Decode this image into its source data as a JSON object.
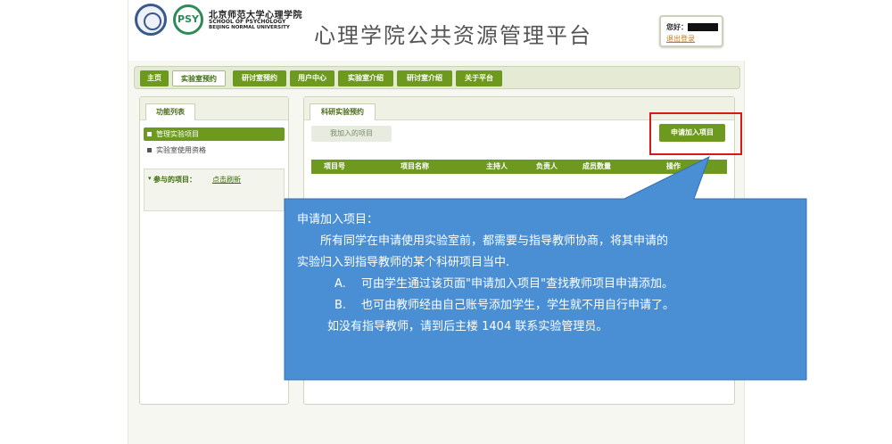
{
  "header": {
    "university_cn": "北京师范大学心理学院",
    "university_en1": "SCHOOL OF PSYCHOLOGY",
    "university_en2": "BEIJING NORMAL UNIVERSITY",
    "psy_logo_text": "PSY",
    "site_title": "心理学院公共资源管理平台",
    "greeting": "您好：",
    "logout": "退出登录"
  },
  "nav": {
    "tabs": [
      {
        "label": "主页"
      },
      {
        "label": "实验室预约"
      },
      {
        "label": "研讨室预约"
      },
      {
        "label": "用户中心"
      },
      {
        "label": "实验室介绍"
      },
      {
        "label": "研讨室介绍"
      },
      {
        "label": "关于平台"
      }
    ],
    "active_index": 1
  },
  "left_panel": {
    "title": "功能列表",
    "items": [
      {
        "label": "管理实验项目"
      },
      {
        "label": "实验室使用资格"
      }
    ],
    "projects_label": "参与的项目：",
    "projects_link": "点击刷新"
  },
  "right_panel": {
    "title": "科研实验预约",
    "sub_tab": "我加入的项目",
    "join_button": "申请加入项目",
    "columns": [
      "项目号",
      "项目名称",
      "主持人",
      "负责人",
      "成员数量",
      "操作"
    ]
  },
  "callout": {
    "heading": "申请加入项目：",
    "para1_line1": "所有同学在申请使用实验室前，都需要与指导教师协商，将其申请的",
    "para1_line2": "实验归入到指导教师的某个科研项目当中.",
    "item_a_mark": "A.",
    "item_a": "可由学生通过该页面\"申请加入项目\"查找教师项目申请添加。",
    "item_b_mark": "B.",
    "item_b": "也可由教师经由自己账号添加学生，学生就不用自行申请了。",
    "note": "如没有指导教师，请到后主楼 1404 联系实验管理员。"
  },
  "colors": {
    "brand_green": "#6d9a1e",
    "callout_blue": "#4a8fd4",
    "highlight_red": "#d61a1a"
  }
}
